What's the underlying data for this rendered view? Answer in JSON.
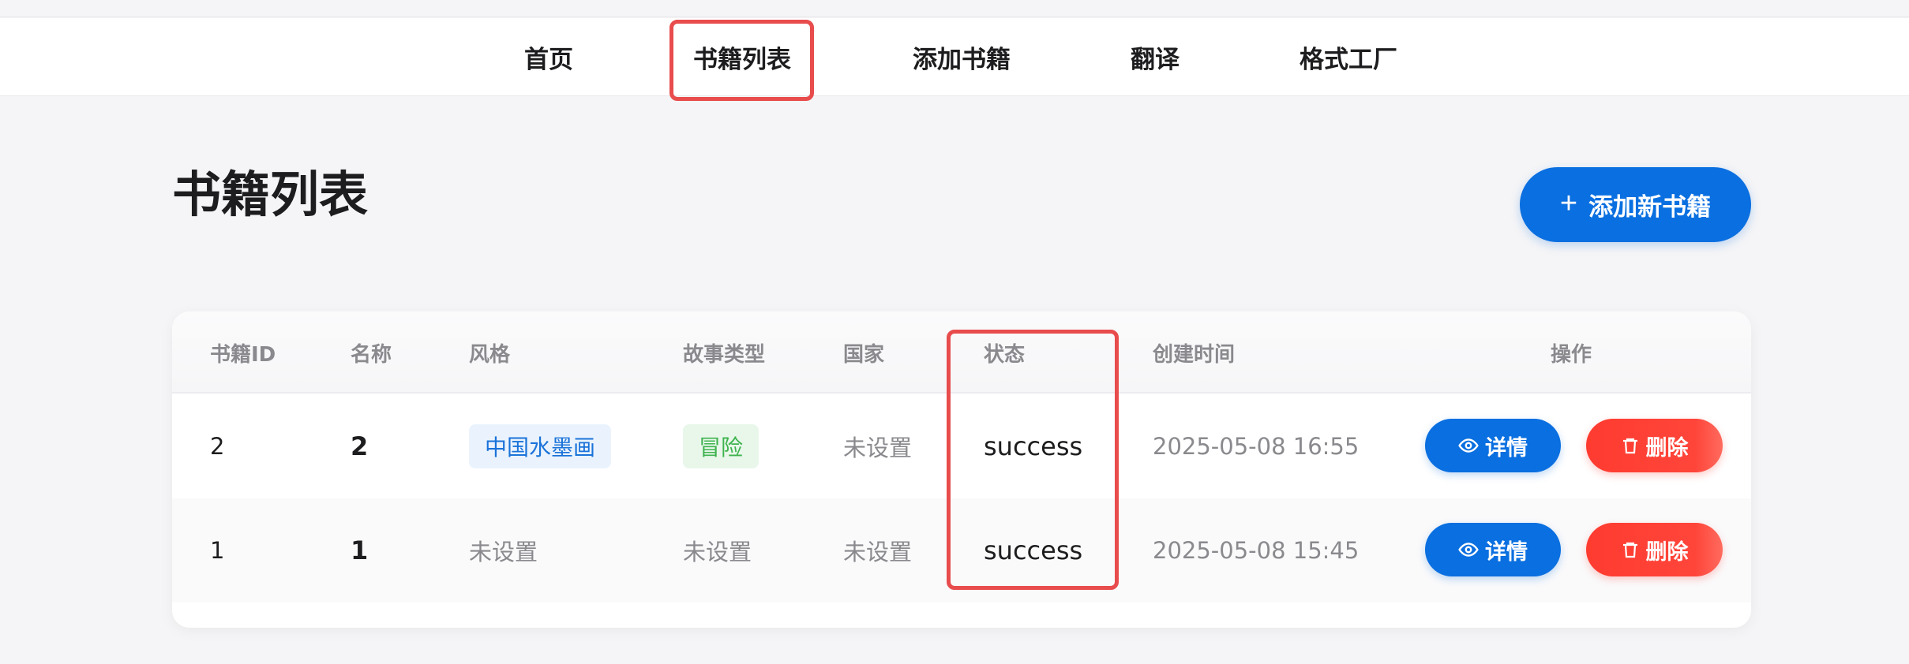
{
  "nav": {
    "items": [
      {
        "label": "首页"
      },
      {
        "label": "书籍列表",
        "active": true
      },
      {
        "label": "添加书籍"
      },
      {
        "label": "翻译"
      },
      {
        "label": "格式工厂"
      }
    ]
  },
  "page": {
    "title": "书籍列表",
    "add_button_label": "添加新书籍",
    "add_button_icon": "plus-icon"
  },
  "table": {
    "headers": [
      "书籍ID",
      "名称",
      "风格",
      "故事类型",
      "国家",
      "状态",
      "创建时间",
      "操作"
    ],
    "rows": [
      {
        "id": "2",
        "name": "2",
        "style": "中国水墨画",
        "type": "冒险",
        "country": "未设置",
        "status": "success",
        "created": "2025-05-08 16:55"
      },
      {
        "id": "1",
        "name": "1",
        "style": "未设置",
        "type": "未设置",
        "country": "未设置",
        "status": "success",
        "created": "2025-05-08 15:45"
      }
    ],
    "actions": {
      "detail_label": "详情",
      "detail_icon": "eye-icon",
      "delete_label": "删除",
      "delete_icon": "trash-icon"
    }
  },
  "colors": {
    "primary": "#0a6fe0",
    "danger": "#ff3b30",
    "highlight": "#e84c4c",
    "tag_blue_bg": "#eaf3fd",
    "tag_green_bg": "#e8f7ea"
  }
}
